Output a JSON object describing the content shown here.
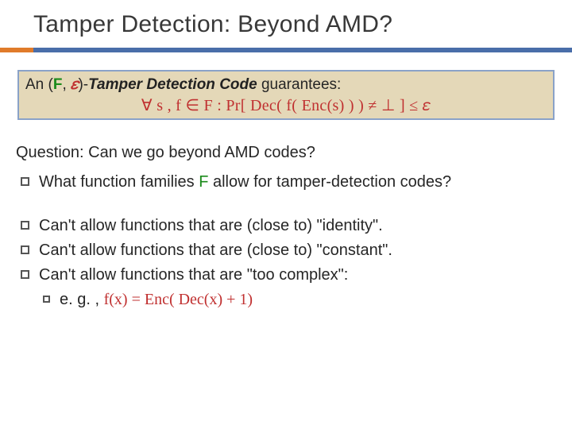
{
  "title": "Tamper Detection: Beyond AMD?",
  "definition": {
    "prefix": "An (",
    "F": "F",
    "comma": ", ",
    "eps": "𝜀",
    "close": ")-",
    "tdc": "Tamper Detection Code",
    "guarantees": "  guarantees:",
    "formula": "∀ s ,  f ∈ F  :  Pr[  Dec( f( Enc(s) ) )  ≠ ⊥ ] ≤ 𝜀"
  },
  "question": "Question:  Can we go beyond AMD codes?",
  "bullets": {
    "b1a": "What function families ",
    "b1F": "F",
    "b1b": " allow for tamper-detection codes?",
    "b2": "Can't allow functions that are (close to) \"identity\".",
    "b3": "Can't allow functions that are (close to) \"constant\".",
    "b4": "Can't allow functions that are \"too complex\":",
    "b5a": "e. g. ,  ",
    "b5fx": "f(x) = Enc( Dec(x) + 1)"
  }
}
